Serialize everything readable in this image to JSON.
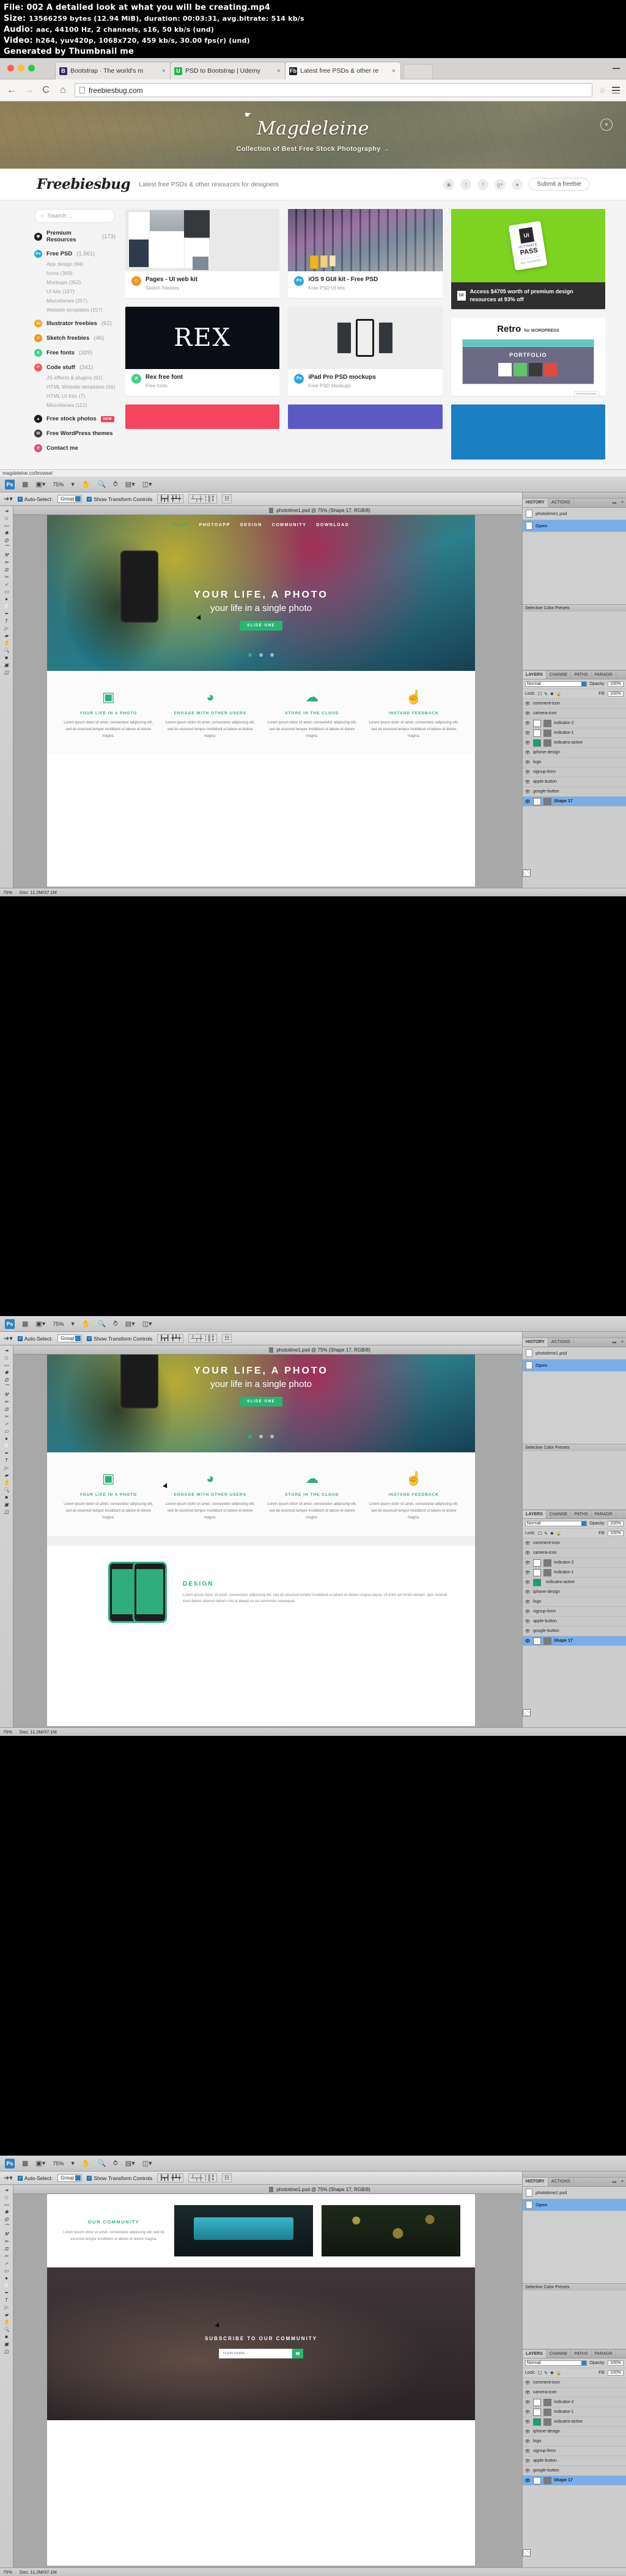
{
  "video_info": {
    "file_label": "File:",
    "file_name": "002 A detailed look at what you will be creating.mp4",
    "size_label": "Size:",
    "size_value": "13566259 bytes (12.94 MiB), duration: 00:03:31, avg.bitrate: 514 kb/s",
    "audio_label": "Audio:",
    "audio_value": "aac, 44100 Hz, 2 channels, s16, 50 kb/s (und)",
    "video_label": "Video:",
    "video_value": "h264, yuv420p, 1068x720, 459 kb/s, 30.00 fps(r) (und)",
    "generated_by": "Generated by Thumbnail me"
  },
  "browser": {
    "tabs": [
      {
        "favicon": "B",
        "favicon_color": "#3b2a6b",
        "label": "Bootstrap · The world's m",
        "close": "×",
        "active": false
      },
      {
        "favicon": "U",
        "favicon_color": "#27b34f",
        "label": "PSD to Bootstrap | Udemy",
        "close": "×",
        "active": false
      },
      {
        "favicon": "Fb",
        "favicon_color": "#222222",
        "label": "Latest free PSDs & other re",
        "close": "×",
        "active": true
      }
    ],
    "back_icon": "←",
    "forward_icon": "→",
    "reload_icon": "C",
    "home_icon": "⌂",
    "url": "freebiesbug.com",
    "star_icon": "☆",
    "menu_icon": "menu-icon",
    "status_url": "magdeleine.co/browse/"
  },
  "banner": {
    "title": "Magdeleine",
    "subtitle": "Collection of Best Free Stock Photography →",
    "close_label": "×"
  },
  "site_header": {
    "logo": "Freebiesbug",
    "tagline": "Latest free PSDs & other resources for designers",
    "social": [
      "◉",
      "t",
      "f",
      "g+",
      "●"
    ],
    "submit_label": "Submit a freebie"
  },
  "sidebar": {
    "search_placeholder": "Search ...",
    "search_icon": "⌕",
    "items": [
      {
        "label": "Premium Resources",
        "count": "(173)",
        "badge": "✺",
        "color": "#1c1c1c",
        "subs": []
      },
      {
        "label": "Free PSD",
        "count": "(1,561)",
        "badge": "Ps",
        "color": "#2ba7dd",
        "subs": [
          "App design (94)",
          "Icons (369)",
          "Mockups (352)",
          "UI kits (157)",
          "Miscellanea (257)",
          "Website templates (157)"
        ]
      },
      {
        "label": "Illustrator freebies",
        "count": "(62)",
        "badge": "Ai",
        "color": "#f5a623",
        "subs": []
      },
      {
        "label": "Sketch freebies",
        "count": "(46)",
        "badge": "◇",
        "color": "#f59322",
        "subs": []
      },
      {
        "label": "Free fonts",
        "count": "(329)",
        "badge": "A",
        "color": "#44d18b",
        "subs": []
      },
      {
        "label": "Code stuff",
        "count": "(341)",
        "badge": "/>",
        "color": "#f05a5a",
        "subs": [
          "JS effects & plugins (91)",
          "HTML Website templates (56)",
          "HTML UI Kits (7)",
          "Miscellanea (112)"
        ]
      },
      {
        "label": "Free stock photos",
        "count": "",
        "badge": "▲",
        "color": "#1c1c1c",
        "new_badge": "NEW",
        "subs": []
      },
      {
        "label": "Free WordPress themes",
        "count": "",
        "badge": "W",
        "color": "#3f3f3f",
        "subs": []
      },
      {
        "label": "Contact me",
        "count": "",
        "badge": "@",
        "color": "#e0457b",
        "subs": []
      }
    ]
  },
  "cards": {
    "col1": [
      {
        "title": "Pages - UI web kit",
        "tags": "Sketch freebies",
        "badge": "◇",
        "badge_color": "#f59322",
        "thumb": "pages"
      },
      {
        "title": "Rex free font",
        "tags": "Free fonts",
        "badge": "A",
        "badge_color": "#44d18b",
        "thumb": "rex",
        "thumb_text": "REX"
      },
      {
        "title": "",
        "tags": "",
        "badge": "",
        "badge_color": "#e0457b",
        "thumb": "red"
      }
    ],
    "col2": [
      {
        "title": "iOS 9 GUI kit - Free PSD",
        "tags": "Free PSD   UI kits",
        "badge": "Ps",
        "badge_color": "#2ba7dd",
        "thumb": "ios"
      },
      {
        "title": "iPad Pro PSD mockups",
        "tags": "Free PSD   Mockups",
        "badge": "Ps",
        "badge_color": "#2ba7dd",
        "thumb": "ipad"
      },
      {
        "title": "",
        "tags": "",
        "badge": "",
        "badge_color": "#6a5acd",
        "thumb": "purple"
      }
    ],
    "ads": {
      "ultimate_pass": {
        "ui_label": "UI",
        "ultimate": "ULTIMATE",
        "pass": "PASS",
        "all_access": "ALL ACCESS",
        "cta": "Access $4705 worth of premium design resources at 93% off",
        "badge": "UI"
      },
      "retro": {
        "title": "Retro",
        "for": "for WORDPRESS",
        "portfolio": "PORTFOLIO",
        "sponsored": "SPONSORED"
      }
    }
  },
  "photoshop": {
    "app_name": "Ps",
    "zoom_level": "75%",
    "doc_title": "phototime1.psd @ 75% (Shape 17, RGB/8)",
    "status_zoom": "75%",
    "status_doc": "Doc: 11.2M/37.1M",
    "options": {
      "auto_select_label": "Auto-Select:",
      "group_value": "Group",
      "show_transform_label": "Show Transform Controls",
      "check_mark": "✓"
    },
    "history_panel": {
      "tabs": [
        "HISTORY",
        "ACTIONS"
      ],
      "active_tab": "HISTORY",
      "doc_name": "phototime1.psd",
      "states": [
        "Open"
      ],
      "selected_state": "Open",
      "preset_label": "Selective Color Presets",
      "collapse_icon": "◂◂",
      "menu_icon": "≡"
    },
    "side_icons": [
      "HISTORY",
      "ACTIONS"
    ],
    "layers_panel": {
      "tabs": [
        "LAYERS",
        "CHANNE",
        "PATHS",
        "PARAGR"
      ],
      "active_tab": "LAYERS",
      "blend_mode": "Normal",
      "opacity_label": "Opacity:",
      "opacity_value": "100%",
      "lock_label": "Lock:",
      "fill_label": "Fill:",
      "fill_value": "100%",
      "layers": [
        {
          "name": "comment-icon",
          "thumb": "dots",
          "mask": false,
          "selected": false
        },
        {
          "name": "camera-icon",
          "thumb": "dots",
          "mask": false,
          "selected": false
        },
        {
          "name": "indicator-2",
          "thumb": "white",
          "mask": true,
          "selected": false
        },
        {
          "name": "indicator-1",
          "thumb": "white",
          "mask": true,
          "selected": false
        },
        {
          "name": "indicatro-active",
          "thumb": "green",
          "mask": true,
          "selected": false
        },
        {
          "name": "iphone-design",
          "thumb": "dots",
          "mask": false,
          "selected": false
        },
        {
          "name": "logo",
          "thumb": "dots",
          "mask": false,
          "selected": false
        },
        {
          "name": "signup-form",
          "thumb": "dots",
          "mask": false,
          "selected": false
        },
        {
          "name": "apple-button",
          "thumb": "dots",
          "mask": false,
          "selected": false
        },
        {
          "name": "google-button",
          "thumb": "dots",
          "mask": false,
          "selected": false
        },
        {
          "name": "Shape 17",
          "thumb": "white",
          "mask": true,
          "selected": true
        }
      ]
    }
  },
  "mockup": {
    "nav": [
      "HOME",
      "PHOTOAPP",
      "DESIGN",
      "COMMUNITY",
      "DOWNLOAD"
    ],
    "nav_active": "HOME",
    "hero_title": "YOUR LIFE, A PHOTO",
    "hero_subtitle": "your life in a single photo",
    "hero_button": "SLIDE ONE",
    "features": [
      {
        "icon": "▣",
        "title": "YOUR LIFE IN A PHOTO",
        "text": "Lorem ipsum dolor sit amet, consectetur adipiscing elit, sed do eiusmod tempor incididunt ut labore et dolore magna."
      },
      {
        "icon": "◕",
        "title": "ENGAGE WITH OTHER USERS",
        "text": "Lorem ipsum dolor sit amet, consectetur adipiscing elit, sed do eiusmod tempor incididunt ut labore et dolore magna."
      },
      {
        "icon": "☁",
        "title": "STORE IN THE CLOUD",
        "text": "Lorem ipsum dolor sit amet, consectetur adipiscing elit, sed do eiusmod tempor incididunt ut labore et dolore magna."
      },
      {
        "icon": "☝",
        "title": "INSTAND FEEDBACK",
        "text": "Lorem ipsum dolor sit amet, consectetur adipiscing elit, sed do eiusmod tempor incididunt ut labore et dolore magna."
      }
    ],
    "design_section": {
      "title": "DESIGN",
      "text": "Lorem ipsum dolor sit amet, consectetur adipiscing elit, sed do eiusmod tempor incididunt ut labore et dolore magna aliqua. Ut enim ad minim veniam, quis nostrud exercitation ullamco laboris nisi ut aliquip ex ea commodo consequat."
    },
    "community_section": {
      "title": "OUR COMMUNITY",
      "text": "Lorem ipsum dolor sit amet, consectetur adipiscing elit, sed do eiusmod tempor incididunt ut labore et dolore magna."
    },
    "subscribe_section": {
      "title": "SUBSCRIBE TO OUR COMMUNITY",
      "email_placeholder": "YOUR EMAIL",
      "submit_icon": "✉"
    }
  }
}
